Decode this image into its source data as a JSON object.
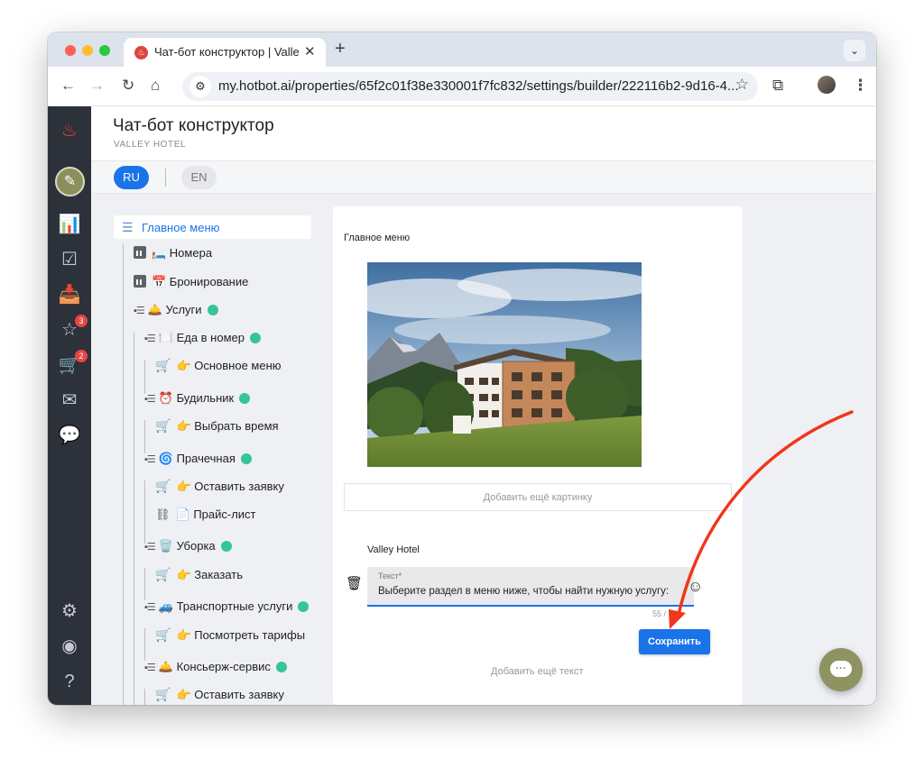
{
  "browser": {
    "tab_title": "Чат-бот конструктор | Valley Hotel",
    "url": "my.hotbot.ai/properties/65f2c01f38e330001f7fc832/settings/builder/222116b2-9d16-4..."
  },
  "header": {
    "title": "Чат-бот конструктор",
    "subtitle": "VALLEY HOTEL"
  },
  "languages": {
    "ru": "RU",
    "en": "EN"
  },
  "sidebar": {
    "badges": {
      "reviews": "3",
      "cart": "2"
    }
  },
  "tree": {
    "root": "Главное меню",
    "items": [
      "🛏️ Номера",
      "📅 Бронирование",
      "🛎️ Услуги",
      "🍽️ Еда в номер",
      "👉 Основное меню",
      "⏰ Будильник",
      "👉 Выбрать время",
      "🌀 Прачечная",
      "👉 Оставить заявку",
      "📄 Прайс-лист",
      "🗑️ Уборка",
      "👉 Заказать",
      "🚙 Транспортные услуги",
      "👉 Посмотреть тарифы",
      "🛎️ Консьерж-сервис",
      "👉 Оставить заявку"
    ]
  },
  "editor": {
    "title": "Главное меню",
    "add_image": "Добавить ещё картинку",
    "hotel_name": "Valley Hotel",
    "text_label": "Текст*",
    "text_value": "Выберите раздел в меню ниже, чтобы найти нужную услугу:",
    "counter": "55 /",
    "save": "Сохранить",
    "add_text": "Добавить ещё текст"
  },
  "colors": {
    "accent": "#1a73e8",
    "sidebar": "#2d313a",
    "annotation_arrow": "#f0361d"
  }
}
